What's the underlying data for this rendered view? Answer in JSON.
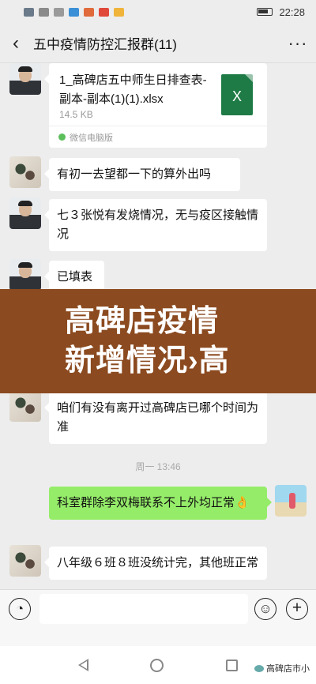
{
  "status_bar": {
    "time": "22:28",
    "battery_level": 0.6
  },
  "header": {
    "title": "五中疫情防控汇报群(11)"
  },
  "messages": [
    {
      "file_name": "1_高碑店五中师生日排查表-副本-副本(1)(1).xlsx",
      "file_size": "14.5 KB",
      "file_icon_text": "X",
      "source": "微信电脑版"
    },
    {
      "text": "有初一去望都一下的算外出吗"
    },
    {
      "text": "七３张悦有发烧情况，无与疫区接触情况"
    },
    {
      "text": "已填表"
    },
    {
      "text": "咱们有没有离开过高碑店已哪个时间为准"
    },
    {
      "text": "科室群除李双梅联系不上外均正常👌"
    },
    {
      "text": "八年级６班８班没统计完，其他班正常"
    }
  ],
  "timestamp": "周一 13:46",
  "banner": {
    "line1": "高碑店疫情",
    "line2": "新增情况›高"
  },
  "input": {
    "voice_symbol": "◔",
    "emoji_symbol": "☺",
    "plus_symbol": "+",
    "value": ""
  },
  "watermark": "高碑店市小"
}
